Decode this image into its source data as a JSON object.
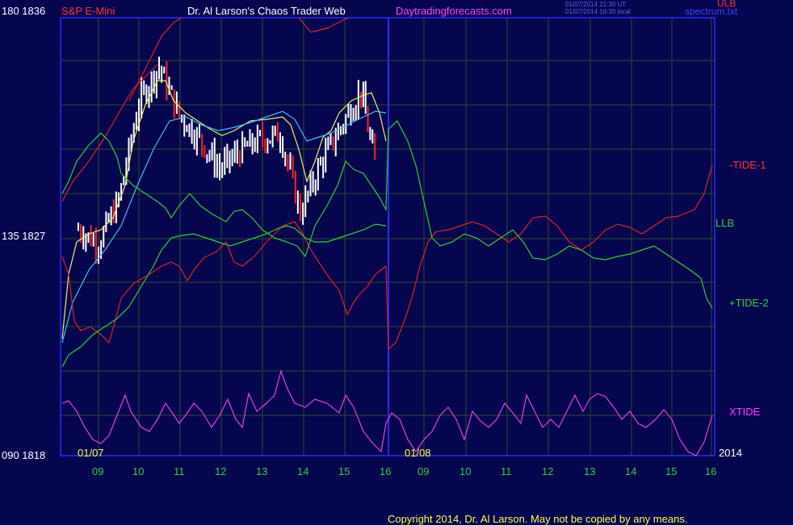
{
  "header": {
    "scale_top_left": "180  1836",
    "instrument": "S&P E-Mini",
    "site_title": "Dr. Al Larson's Chaos Trader Web",
    "site_url": "Daytradingforecasts.com",
    "timestamp_ut": "01/07/2014 21:30 UT",
    "timestamp_local": "01/07/2014 16:30 local",
    "ulb_label": "ULB",
    "file_label": "spectrum.txt"
  },
  "axis": {
    "left_mid": "135  1827",
    "left_bottom": "090  1818",
    "date_left": "01/07",
    "date_mid": "01/08",
    "year": "2014",
    "hours": [
      "09",
      "10",
      "11",
      "12",
      "13",
      "14",
      "15",
      "16",
      "09",
      "10",
      "11",
      "12",
      "13",
      "14",
      "15",
      "16"
    ]
  },
  "footer": {
    "copyright": "Copyright 2014, Dr. Al Larson. May not be copied by any means."
  },
  "colors": {
    "background": "#06064f",
    "frame": "#2a2aff",
    "grid": "#2d4b2d",
    "tide1": "#e02020",
    "tide2": "#30d030",
    "llb": "#30d030",
    "xtide": "#e040e0",
    "avg_fast": "#f0f060",
    "avg_slow": "#40c0f0",
    "candle_up": "#ffffff",
    "candle_down": "#ff2020"
  },
  "chart_data": {
    "type": "line",
    "title": "S&P E-Mini",
    "xlabel": "",
    "ylabel": "",
    "ylim": [
      1818,
      1836
    ],
    "y_ticks": [
      1818,
      1827,
      1836
    ],
    "right_labels": [
      "ULB",
      "-TIDE-1",
      "LLB",
      "+TIDE-2",
      "XTIDE"
    ],
    "x_hours": [
      9,
      10,
      11,
      12,
      13,
      14,
      15,
      16,
      9,
      10,
      11,
      12,
      13,
      14,
      15,
      16
    ],
    "price_approx": {
      "x_hour_day1": [
        8.5,
        9.0,
        9.5,
        10.0,
        10.5,
        11.0,
        11.5,
        12.0,
        12.5,
        13.0,
        13.5,
        14.0,
        14.5,
        15.0,
        15.5,
        15.9
      ],
      "close": [
        1827.3,
        1826.7,
        1828.5,
        1832.5,
        1834.0,
        1832.0,
        1831.0,
        1829.8,
        1830.5,
        1831.0,
        1831.2,
        1828.0,
        1830.0,
        1831.5,
        1833.0,
        1829.5
      ]
    },
    "series": [
      {
        "name": "-TIDE-1",
        "style": "red"
      },
      {
        "name": "+TIDE-2",
        "style": "green"
      },
      {
        "name": "LLB",
        "style": "green"
      },
      {
        "name": "ULB",
        "style": "red"
      },
      {
        "name": "XTIDE",
        "style": "magenta"
      }
    ]
  }
}
